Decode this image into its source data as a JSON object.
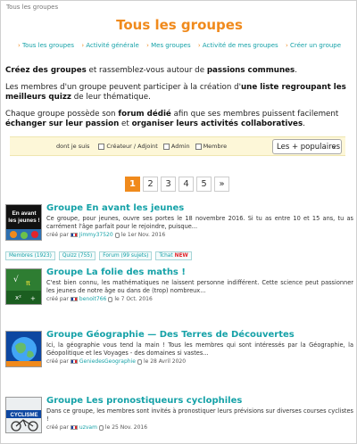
{
  "breadcrumb": "Tous les groupes",
  "title": "Tous les groupes",
  "nav": [
    "Tous les groupes",
    "Activité générale",
    "Mes groupes",
    "Activité de mes groupes",
    "Créer un groupe"
  ],
  "intro": {
    "p1_a": "Créez des groupes",
    "p1_b": " et rassemblez-vous autour de ",
    "p1_c": "passions communes",
    "p1_d": ".",
    "p2_a": "Les membres d'un groupe peuvent participer à la création d'",
    "p2_b": "une liste regroupant les meilleurs quizz",
    "p2_c": " de leur thématique.",
    "p3_a": "Chaque groupe possède son ",
    "p3_b": "forum dédié",
    "p3_c": " afin que ses membres puissent facilement ",
    "p3_d": "échanger sur leur passion",
    "p3_e": " et ",
    "p3_f": "organiser leurs activités collaboratives",
    "p3_g": "."
  },
  "filter": {
    "label": "dont je suis",
    "options": [
      "Créateur / Adjoint",
      "Admin",
      "Membre"
    ],
    "sort_value": "Les + populaires"
  },
  "pagination": [
    "1",
    "2",
    "3",
    "4",
    "5",
    "»"
  ],
  "groups": [
    {
      "title": "Groupe En avant les jeunes",
      "desc": "Ce groupe, pour jeunes, ouvre ses portes le 18 novembre 2016. Si tu as entre 10 et 15 ans, tu as carrément l'âge parfait pour le rejoindre, puisque...",
      "created_by": "créé par",
      "user": "Jimmy37520",
      "date": "le 1er Nov. 2016",
      "thumb_text": "En avant les jeunes !"
    },
    {
      "title": "Groupe La folie des maths !",
      "desc": "C'est bien connu, les mathématiques ne laissent personne indifférent. Cette science peut passionner les jeunes de notre âge ou dans de (trop) nombreux...",
      "created_by": "créé par",
      "user": "benoit766",
      "date": "le 7 Oct. 2016",
      "thumb_text": ""
    },
    {
      "title": "Groupe Géographie — Des Terres de Découvertes",
      "desc": "Ici, la géographie vous tend la main ! Tous les membres qui sont intéressés par la Géographie, la Géopolitique et les Voyages - des domaines si vastes...",
      "created_by": "créé par",
      "user": "GeniedesGeographie",
      "date": "le 28 Avril 2020",
      "thumb_text": ""
    },
    {
      "title": "Groupe Les pronostiqueurs cyclophiles",
      "desc": "Dans ce groupe, les membres sont invités à pronostiquer leurs prévisions sur diverses courses cyclistes !",
      "created_by": "créé par",
      "user": "uzvam",
      "date": "le 25 Nov. 2016",
      "thumb_text": "CYCLISME"
    }
  ],
  "stats": {
    "members": "Membres (1923)",
    "quizz": "Quizz (755)",
    "forum": "Forum (99 sujets)",
    "tchat": "Tchat",
    "new": "NEW"
  },
  "colors": {
    "accent": "#f08a1c",
    "link": "#16a2a8",
    "filter_bg": "#fdf7d8"
  }
}
